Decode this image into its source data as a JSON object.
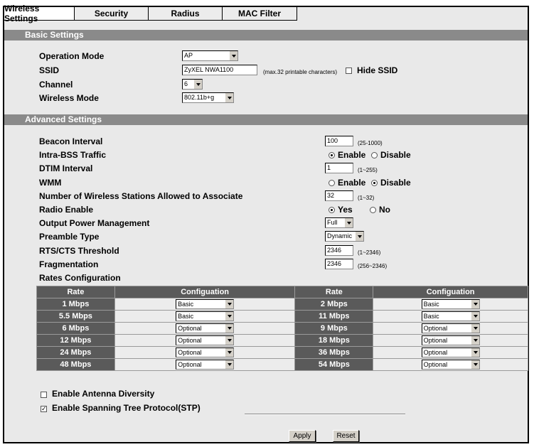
{
  "tabs": [
    "Wireless Settings",
    "Security",
    "Radius",
    "MAC Filter"
  ],
  "basic": {
    "header": "Basic Settings",
    "operation_mode_label": "Operation Mode",
    "operation_mode_value": "AP",
    "ssid_label": "SSID",
    "ssid_value": "ZyXEL NWA1100",
    "ssid_hint": "(max.32 printable characters)",
    "hide_ssid_label": "Hide SSID",
    "channel_label": "Channel",
    "channel_value": "6",
    "wireless_mode_label": "Wireless Mode",
    "wireless_mode_value": "802.11b+g"
  },
  "advanced": {
    "header": "Advanced Settings",
    "beacon_label": "Beacon Interval",
    "beacon_value": "100",
    "beacon_hint": "(25-1000)",
    "intra_label": "Intra-BSS Traffic",
    "enable_label": "Enable",
    "disable_label": "Disable",
    "dtim_label": "DTIM Interval",
    "dtim_value": "1",
    "dtim_hint": "(1~255)",
    "wmm_label": "WMM",
    "stations_label": "Number of Wireless Stations Allowed to Associate",
    "stations_value": "32",
    "stations_hint": "(1~32)",
    "radio_label": "Radio Enable",
    "yes_label": "Yes",
    "no_label": "No",
    "power_label": "Output Power Management",
    "power_value": "Full",
    "preamble_label": "Preamble Type",
    "preamble_value": "Dynamic",
    "rts_label": "RTS/CTS Threshold",
    "rts_value": "2346",
    "rts_hint": "(1~2346)",
    "frag_label": "Fragmentation",
    "frag_value": "2346",
    "frag_hint": "(256~2346)",
    "rates_label": "Rates Configuration"
  },
  "rates": {
    "headers": [
      "Rate",
      "Configuation",
      "Rate",
      "Configuation"
    ],
    "rows": [
      {
        "rate1": "1 Mbps",
        "conf1": "Basic",
        "rate2": "2 Mbps",
        "conf2": "Basic"
      },
      {
        "rate1": "5.5 Mbps",
        "conf1": "Basic",
        "rate2": "11 Mbps",
        "conf2": "Basic"
      },
      {
        "rate1": "6 Mbps",
        "conf1": "Optional",
        "rate2": "9 Mbps",
        "conf2": "Optional"
      },
      {
        "rate1": "12 Mbps",
        "conf1": "Optional",
        "rate2": "18 Mbps",
        "conf2": "Optional"
      },
      {
        "rate1": "24 Mbps",
        "conf1": "Optional",
        "rate2": "36 Mbps",
        "conf2": "Optional"
      },
      {
        "rate1": "48 Mbps",
        "conf1": "Optional",
        "rate2": "54 Mbps",
        "conf2": "Optional"
      }
    ]
  },
  "options": {
    "antenna_label": "Enable Antenna Diversity",
    "stp_label": "Enable Spanning Tree Protocol(STP)"
  },
  "buttons": {
    "apply": "Apply",
    "reset": "Reset"
  }
}
